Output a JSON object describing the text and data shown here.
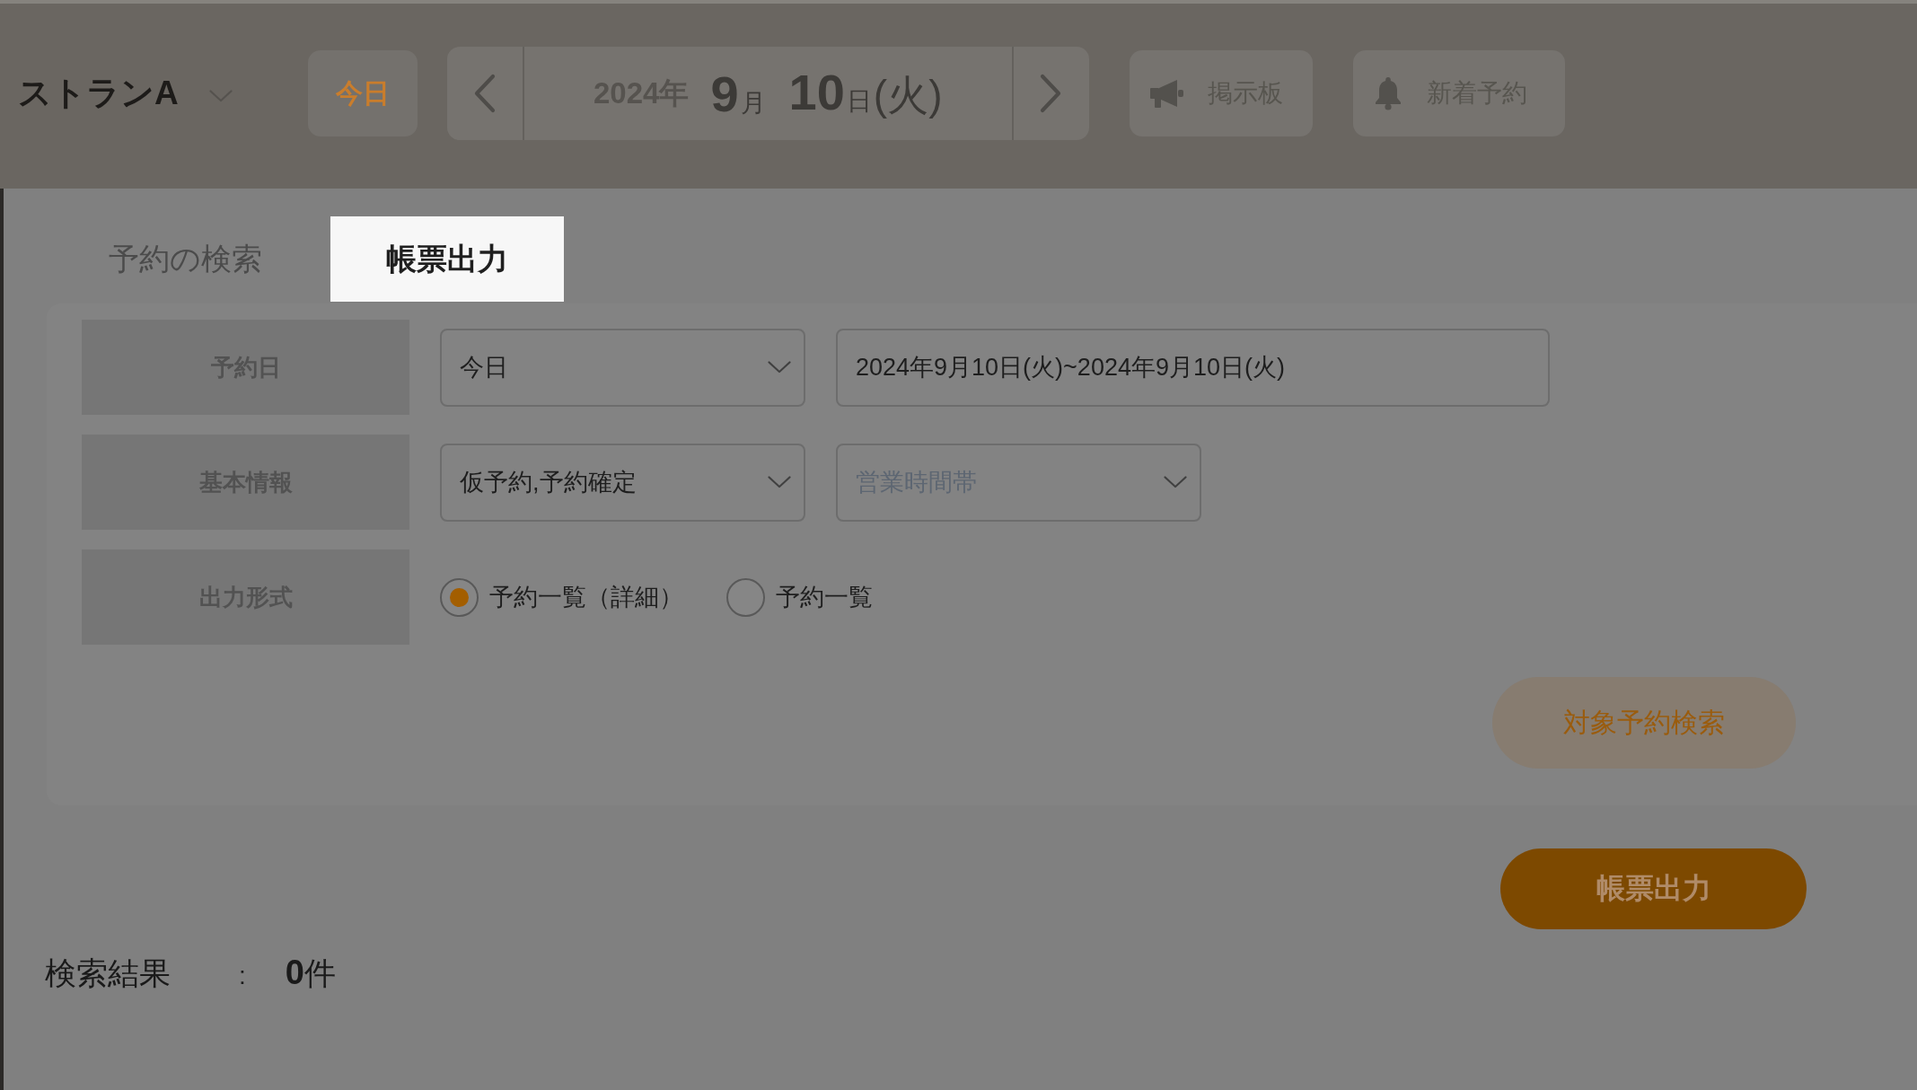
{
  "header": {
    "store_selector": {
      "name": "ストランA"
    },
    "today_button": "今日",
    "date": {
      "year": "2024年",
      "month": "9",
      "month_unit": "月",
      "day": "10",
      "day_unit": "日",
      "weekday": "(火)"
    },
    "buttons": [
      {
        "kind": "bulletin",
        "label": "掲示板"
      },
      {
        "kind": "notifications",
        "label": "新着予約"
      }
    ]
  },
  "tabs": [
    {
      "label": "予約の検索",
      "selected": false
    },
    {
      "label": "帳票出力",
      "selected": true
    }
  ],
  "form": {
    "rows": [
      {
        "label": "予約日",
        "fields": [
          {
            "kind": "select",
            "value": "今日"
          },
          {
            "kind": "text",
            "value": "2024年9月10日(火)~2024年9月10日(火)"
          }
        ]
      },
      {
        "label": "基本情報",
        "fields": [
          {
            "kind": "select",
            "value": "仮予約,予約確定"
          },
          {
            "kind": "select",
            "placeholder": "営業時間帯"
          }
        ]
      },
      {
        "label": "出力形式",
        "fields": [
          {
            "kind": "radio",
            "label": "予約一覧（詳細）",
            "selected": true
          },
          {
            "kind": "radio",
            "label": "予約一覧",
            "selected": false
          }
        ]
      }
    ],
    "search_button": "対象予約検索"
  },
  "export_button": "帳票出力",
  "result": {
    "label": "検索結果",
    "separator": ":",
    "count": "**0**件"
  }
}
